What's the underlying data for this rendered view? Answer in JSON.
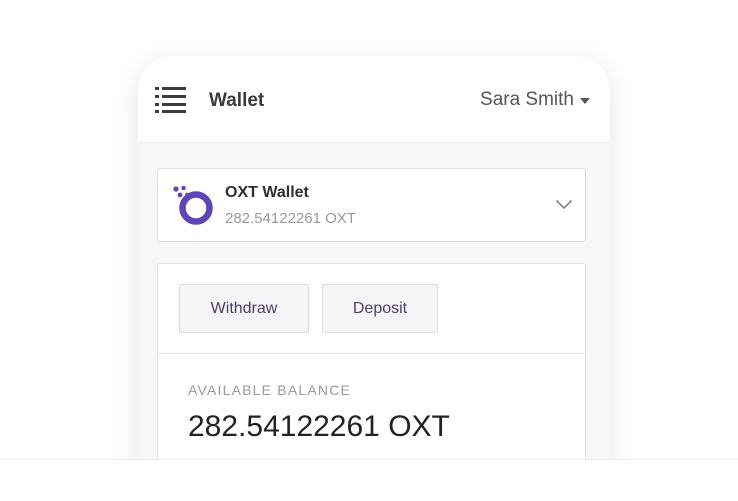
{
  "header": {
    "title": "Wallet",
    "user_name": "Sara Smith",
    "menu_icon": "hamburger-menu-icon",
    "user_caret_icon": "caret-down-icon"
  },
  "wallet_selector": {
    "name": "OXT Wallet",
    "amount": "282.54122261 OXT",
    "logo": "orchid-oxt-logo",
    "chevron_icon": "chevron-down-icon"
  },
  "actions": {
    "withdraw_label": "Withdraw",
    "deposit_label": "Deposit"
  },
  "balance": {
    "label": "AVAILABLE BALANCE",
    "value": "282.54122261 OXT"
  },
  "colors": {
    "brand_purple": "#5f45ba",
    "button_text": "#4a3f6b",
    "text_dark": "#222222",
    "text_muted": "#9a9a9a"
  }
}
